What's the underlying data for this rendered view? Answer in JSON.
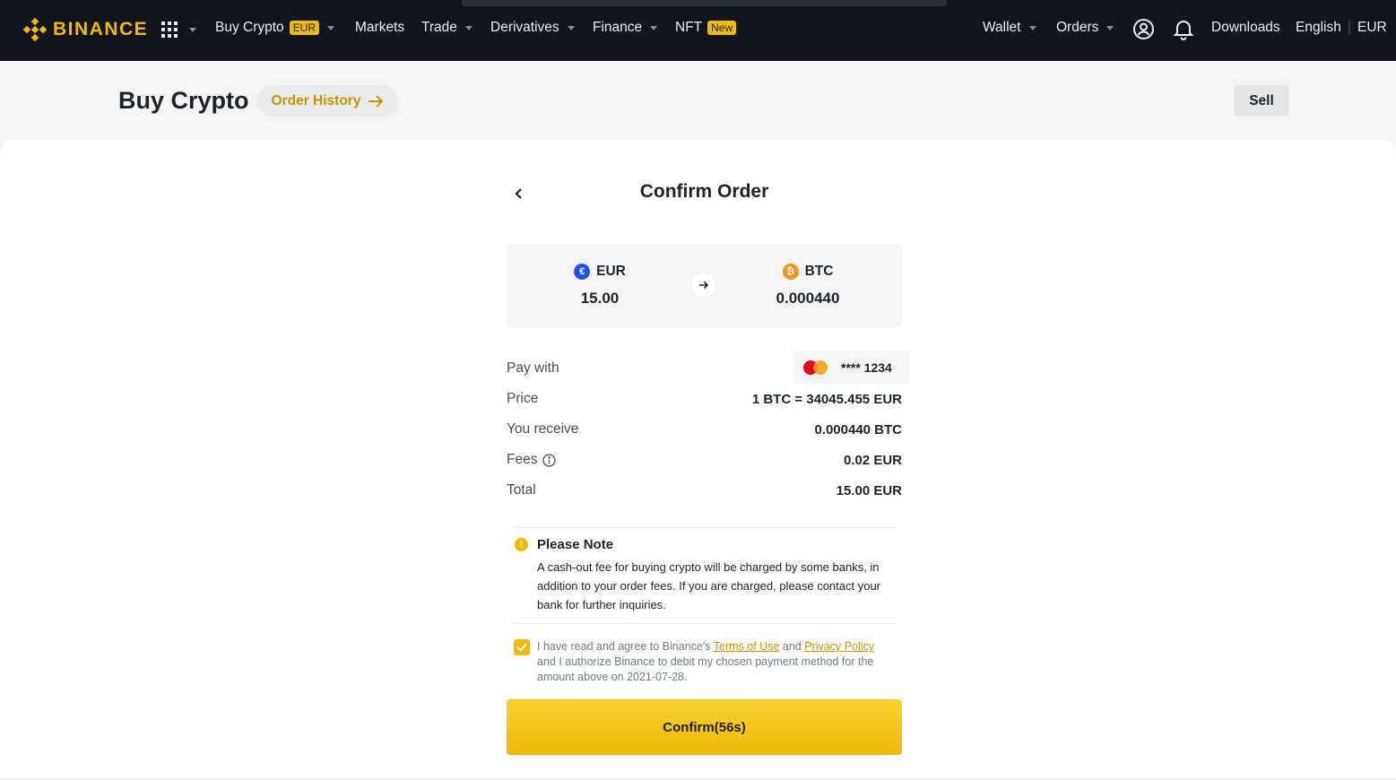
{
  "nav": {
    "brand": "BINANCE",
    "buy_crypto": "Buy Crypto",
    "buy_crypto_badge": "EUR",
    "markets": "Markets",
    "trade": "Trade",
    "derivatives": "Derivatives",
    "finance": "Finance",
    "nft": "NFT",
    "nft_badge": "New",
    "wallet": "Wallet",
    "orders": "Orders",
    "downloads": "Downloads",
    "language": "English",
    "currency": "EUR",
    "icons": [
      "grid-menu-icon",
      "user-circle-icon",
      "bell-icon"
    ]
  },
  "header": {
    "title": "Buy Crypto",
    "order_history": "Order History",
    "sell": "Sell"
  },
  "confirm": {
    "title": "Confirm Order",
    "from": {
      "symbol": "EUR",
      "amount": "15.00",
      "icon_glyph": "€",
      "color": "#2354e6"
    },
    "to": {
      "symbol": "BTC",
      "amount": "0.000440",
      "icon_glyph": "₿",
      "color": "#f7931a"
    },
    "pay_with_label": "Pay with",
    "card_masked": "**** 1234",
    "price_label": "Price",
    "price_value": "1 BTC = 34045.455 EUR",
    "receive_label": "You receive",
    "receive_value": "0.000440 BTC",
    "fees_label": "Fees",
    "fees_value": "0.02 EUR",
    "total_label": "Total",
    "total_value": "15.00 EUR"
  },
  "note": {
    "title": "Please Note",
    "text": "A cash-out fee for buying crypto will be charged by some banks, in addition to your order fees. If you are charged, please contact your bank for further inquiries."
  },
  "agreement": {
    "checked": true,
    "prefix": "I have read and agree to Binance's ",
    "terms": "Terms of Use",
    "and": " and ",
    "privacy": "Privacy Policy",
    "suffix": " and I authorize Binance to debit my chosen payment method for the amount above on 2021-07-28."
  },
  "button": {
    "confirm": "Confirm(56s)"
  },
  "colors": {
    "brand": "#f0b90b",
    "link": "#c99400",
    "nav_bg": "#12161c"
  }
}
